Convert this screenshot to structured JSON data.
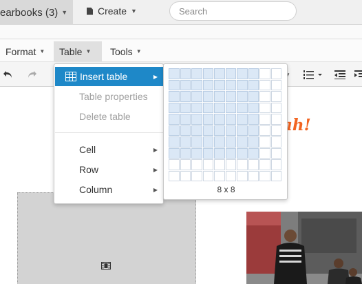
{
  "topbar": {
    "yearbooks_label": "earbooks (3)",
    "create_label": "Create",
    "search_placeholder": "Search"
  },
  "menubar": {
    "items": [
      {
        "label": "Format"
      },
      {
        "label": "Table"
      },
      {
        "label": "Tools"
      }
    ]
  },
  "editor": {
    "heading_fragment": "ah!"
  },
  "table_menu": {
    "items": [
      {
        "label": "Insert table"
      },
      {
        "label": "Table properties"
      },
      {
        "label": "Delete table"
      },
      {
        "label": "Cell"
      },
      {
        "label": "Row"
      },
      {
        "label": "Column"
      }
    ]
  },
  "grid_picker": {
    "columns": 10,
    "rows": 10,
    "selected_columns": 8,
    "selected_rows": 8,
    "caption": "8 x 8"
  },
  "colors": {
    "accent": "#1e88c8",
    "heading_orange": "#f26522",
    "grid_selected": "#dbe8f6"
  },
  "icons": [
    "document-icon",
    "undo-icon",
    "redo-icon",
    "numbered-list-icon",
    "outdent-icon",
    "indent-icon",
    "table-icon",
    "film-icon",
    "caret-down-icon",
    "caret-right-icon"
  ]
}
